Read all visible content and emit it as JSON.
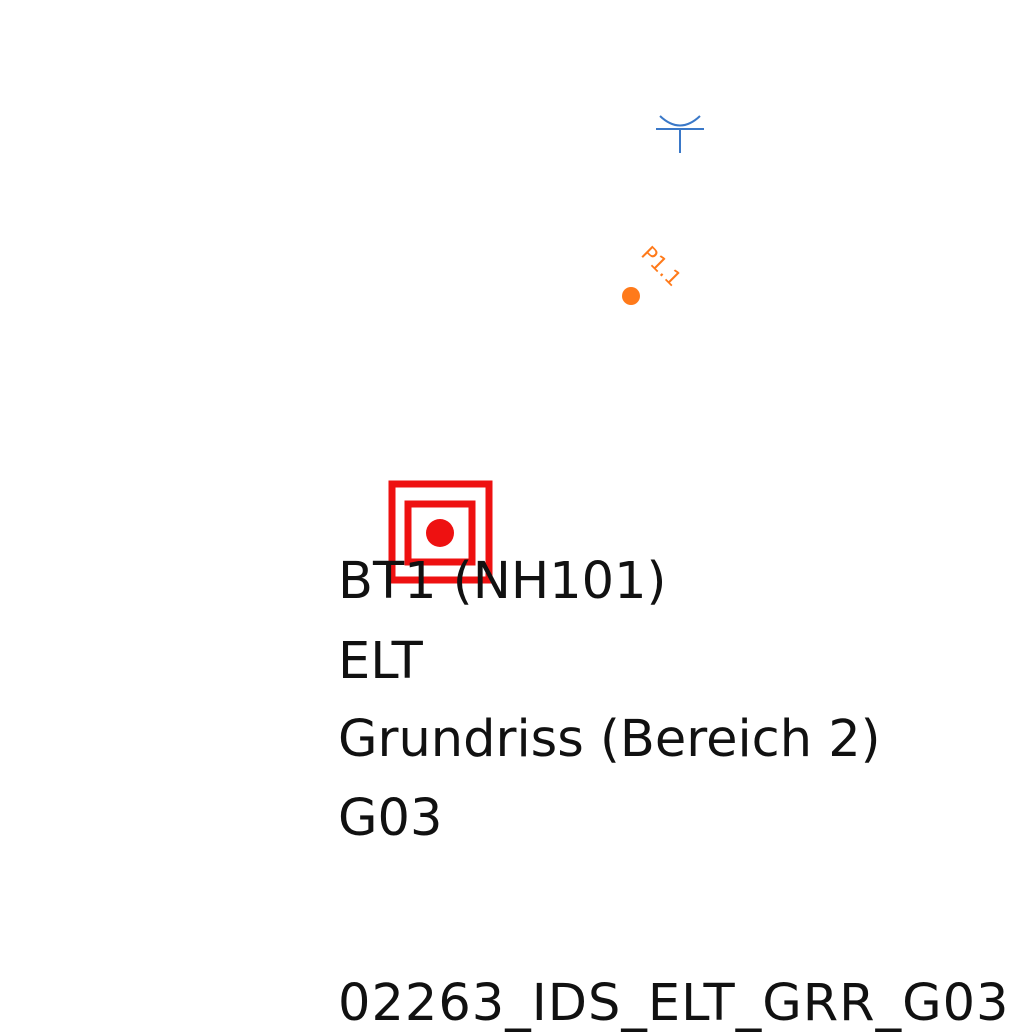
{
  "drawing": {
    "point_label": "P1.1",
    "info_lines": [
      "BT1 (NH101)",
      "ELT",
      "Grundriss (Bereich 2)",
      "G03"
    ],
    "footer_code": "02263_IDS_ELT_GRR_G03"
  },
  "symbols": {
    "antenna": {
      "icon": "antenna-icon",
      "color": "#3a78c8"
    },
    "point_marker": {
      "icon": "point-marker-icon",
      "color": "#ff7a1a"
    },
    "fire_alarm_button": {
      "icon": "fire-alarm-button-icon",
      "color": "#ee1111"
    }
  }
}
